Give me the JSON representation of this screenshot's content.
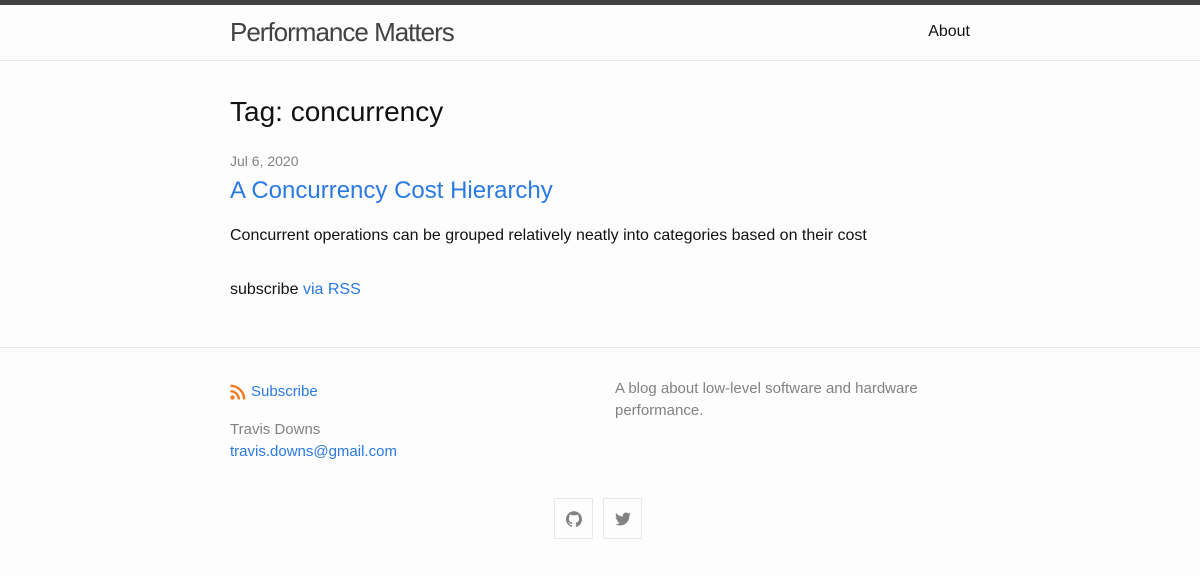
{
  "header": {
    "site_title": "Performance Matters",
    "nav": [
      {
        "label": "About"
      }
    ]
  },
  "main": {
    "page_heading": "Tag: concurrency",
    "posts": [
      {
        "date": "Jul 6, 2020",
        "title": "A Concurrency Cost Hierarchy",
        "excerpt": "Concurrent operations can be grouped relatively neatly into categories based on their cost"
      }
    ],
    "subscribe_prefix": "subscribe",
    "subscribe_link": "via RSS"
  },
  "footer": {
    "subscribe_label": "Subscribe",
    "author_name": "Travis Downs",
    "author_email": "travis.downs@gmail.com",
    "description": "A blog about low-level software and hardware performance.",
    "social": [
      {
        "icon": "github-icon"
      },
      {
        "icon": "twitter-icon"
      }
    ]
  },
  "colors": {
    "accent": "#2a7ae2",
    "rss": "#f27a24",
    "muted": "#828282",
    "top_bar": "#424242"
  }
}
